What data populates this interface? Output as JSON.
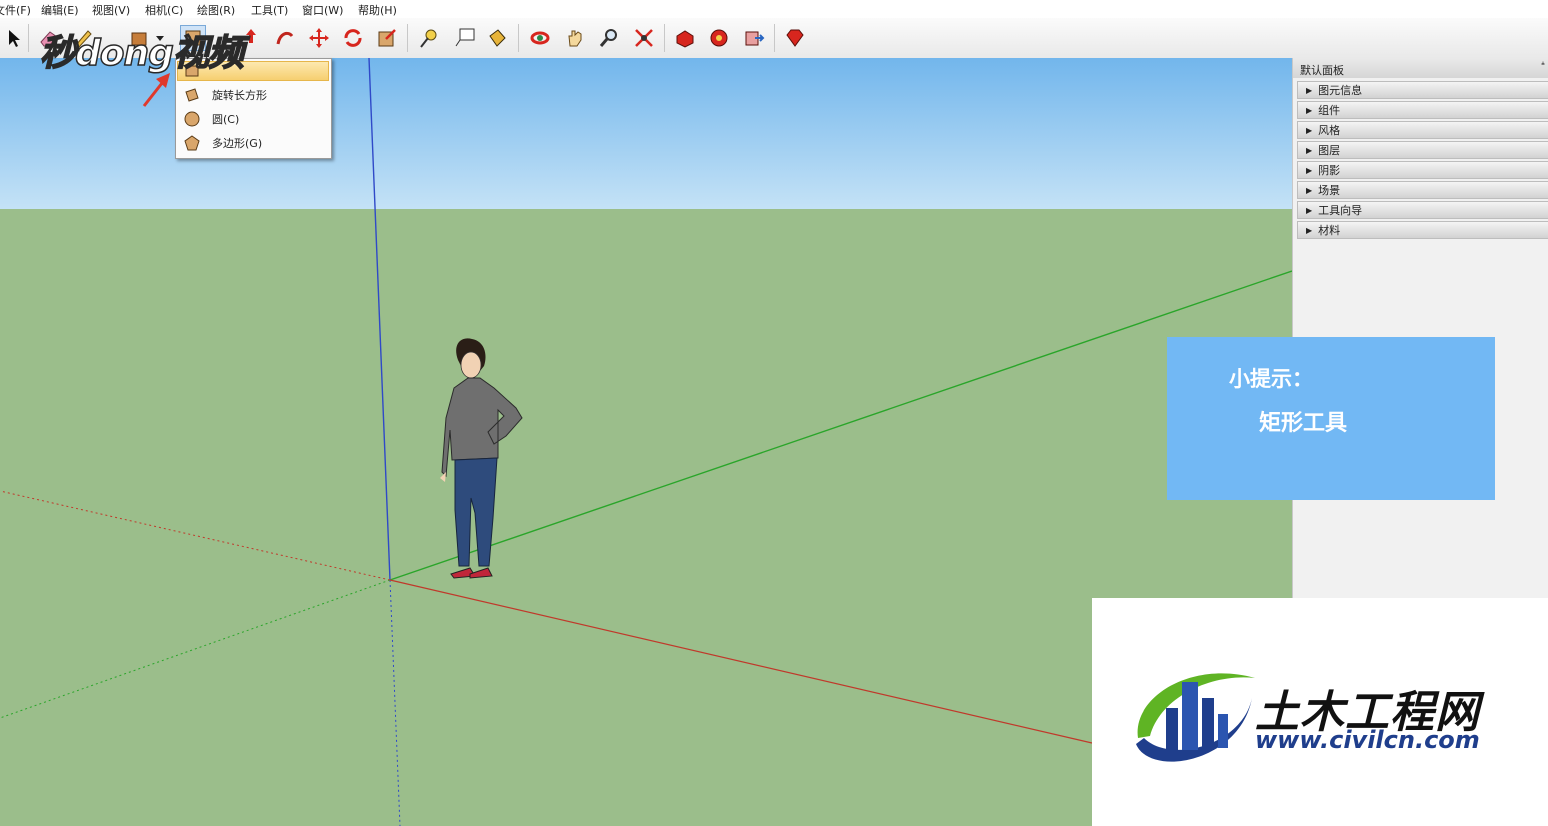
{
  "menubar": {
    "items": [
      {
        "label": "文件(F)"
      },
      {
        "label": "编辑(E)"
      },
      {
        "label": "视图(V)"
      },
      {
        "label": "相机(C)"
      },
      {
        "label": "绘图(R)"
      },
      {
        "label": "工具(T)"
      },
      {
        "label": "窗口(W)"
      },
      {
        "label": "帮助(H)"
      }
    ]
  },
  "toolbar": {
    "tools": [
      "select-arrow-icon",
      "eraser-icon",
      "pencil-icon",
      "paint-icon",
      "dropdown-arrow-icon",
      "rectangle-tool-icon",
      "push-pull-icon",
      "follow-me-icon",
      "move-icon",
      "rotate-icon",
      "scale-icon",
      "tape-measure-icon",
      "text-label-icon",
      "paint-bucket-icon",
      "orbit-icon",
      "pan-icon",
      "zoom-icon",
      "zoom-extents-icon",
      "warehouse-icon",
      "extension-warehouse-icon",
      "share-model-icon",
      "ruby-icon"
    ]
  },
  "watermark": {
    "text": "秒dong视频"
  },
  "dropdown": {
    "items": [
      {
        "label": ""
      },
      {
        "label": "旋转长方形"
      },
      {
        "label": "圆(C)"
      },
      {
        "label": "多边形(G)"
      }
    ]
  },
  "panel": {
    "title": "默认面板",
    "pin": "ᗮ",
    "items": [
      {
        "label": "图元信息"
      },
      {
        "label": "组件"
      },
      {
        "label": "风格"
      },
      {
        "label": "图层"
      },
      {
        "label": "阴影"
      },
      {
        "label": "场景"
      },
      {
        "label": "工具向导"
      },
      {
        "label": "材料"
      }
    ]
  },
  "tip": {
    "heading": "小提示：",
    "body": "矩形工具"
  },
  "logo": {
    "name": "土木工程网",
    "url": "www.civilcn.com"
  },
  "colors": {
    "sky_top": "#72b6ec",
    "ground": "#9bbe8b",
    "axis_blue": "#2f49c8",
    "axis_green": "#2aa52a",
    "axis_red": "#c0392b",
    "tip_bg": "#72b8f4",
    "logo_blue": "#1f3e8c",
    "logo_green": "#5fb424"
  }
}
